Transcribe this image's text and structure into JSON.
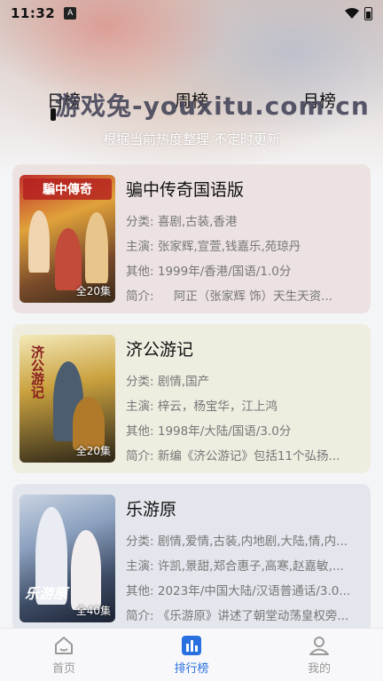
{
  "status": {
    "time": "11:32",
    "a_label": "A"
  },
  "watermark": "游戏兔-youxitu.com.cn",
  "tabs": [
    {
      "label": "日榜",
      "active": true
    },
    {
      "label": "周榜",
      "active": false
    },
    {
      "label": "月榜",
      "active": false
    }
  ],
  "subtitle": "根据当前热度整理 不定时更新",
  "items": [
    {
      "title": "骗中传奇国语版",
      "poster_text": "騙中傳奇",
      "episodes": "全20集",
      "category_label": "分类:",
      "category": "喜剧,古装,香港",
      "cast_label": "主演:",
      "cast": "张家辉,宣萱,钱嘉乐,苑琼丹",
      "other_label": "其他:",
      "other": "1999年/香港/国语/1.0分",
      "intro_label": "简介:",
      "intro": "阿正（张家辉 饰）天生天资..."
    },
    {
      "title": "济公游记",
      "poster_text": "济公游记",
      "episodes": "全20集",
      "category_label": "分类:",
      "category": "剧情,国产",
      "cast_label": "主演:",
      "cast": "梓云，杨宝华，江上鸿",
      "other_label": "其他:",
      "other": "1998年/大陆/国语/3.0分",
      "intro_label": "简介:",
      "intro": "新编《济公游记》包括11个弘扬..."
    },
    {
      "title": "乐游原",
      "poster_text": "乐游原",
      "episodes": "全40集",
      "category_label": "分类:",
      "category": "剧情,爱情,古装,内地剧,大陆,情,内...",
      "cast_label": "主演:",
      "cast": "许凯,景甜,郑合惠子,高寒,赵嘉敏,...",
      "other_label": "其他:",
      "other": "2023年/中国大陆/汉语普通话/3.0...",
      "intro_label": "简介:",
      "intro": "《乐游原》讲述了朝堂动荡皇权旁..."
    }
  ],
  "nav": [
    {
      "label": "首页",
      "icon": "home-icon",
      "active": false
    },
    {
      "label": "排行榜",
      "icon": "ranking-icon",
      "active": true
    },
    {
      "label": "我的",
      "icon": "profile-icon",
      "active": false
    }
  ],
  "colors": {
    "accent": "#2a6fe0",
    "text_muted": "#777777"
  }
}
